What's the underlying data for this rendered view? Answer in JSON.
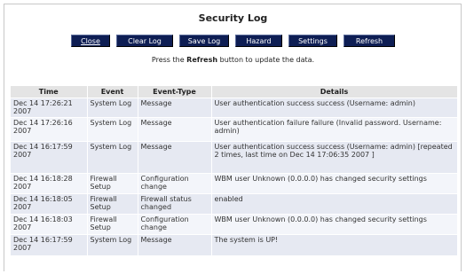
{
  "title": "Security Log",
  "toolbar": {
    "close_label": "Close",
    "clear_label": "Clear Log",
    "save_label": "Save Log",
    "hazard_label": "Hazard",
    "settings_label": "Settings",
    "refresh_label": "Refresh"
  },
  "hint": {
    "before": "Press the ",
    "keyword": "Refresh",
    "after": " button to update the data."
  },
  "table": {
    "headers": [
      "Time",
      "Event",
      "Event-Type",
      "Details"
    ],
    "rows": [
      {
        "time": "Dec 14 17:26:21 2007",
        "event": "System Log",
        "type": "Message",
        "details": "User authentication success success (Username: admin)"
      },
      {
        "time": "Dec 14 17:26:16 2007",
        "event": "System Log",
        "type": "Message",
        "details": "User authentication failure failure (Invalid password. Username: admin)"
      },
      {
        "time": "Dec 14 16:17:59 2007",
        "event": "System Log",
        "type": "Message",
        "details": "User authentication success success (Username: admin) [repeated 2 times, last time on Dec 14 17:06:35 2007 ]"
      },
      {
        "time": "Dec 14 16:18:28 2007",
        "event": "Firewall Setup",
        "type": "Configuration change",
        "details": "WBM user Unknown (0.0.0.0) has changed security settings"
      },
      {
        "time": "Dec 14 16:18:05 2007",
        "event": "Firewall Setup",
        "type": "Firewall status changed",
        "details": "enabled"
      },
      {
        "time": "Dec 14 16:18:03 2007",
        "event": "Firewall Setup",
        "type": "Configuration change",
        "details": "WBM user Unknown (0.0.0.0) has changed security settings"
      },
      {
        "time": "Dec 14 16:17:59 2007",
        "event": "System Log",
        "type": "Message",
        "details": "The system is UP!"
      }
    ]
  }
}
